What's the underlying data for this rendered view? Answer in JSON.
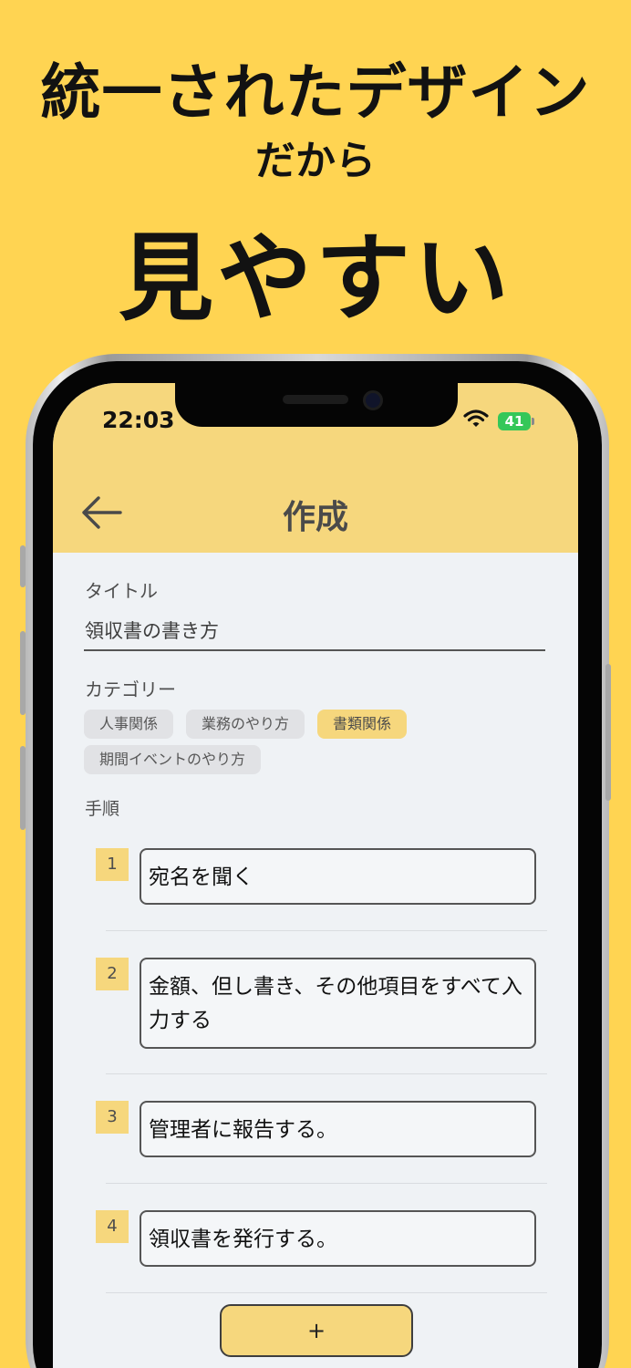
{
  "promo": {
    "line1": "統一されたデザイン",
    "line2": "だから",
    "line3": "見やすい"
  },
  "status_bar": {
    "time": "22:03",
    "battery": "41"
  },
  "header": {
    "title": "作成"
  },
  "form": {
    "title_label": "タイトル",
    "title_value": "領収書の書き方",
    "category_label": "カテゴリー",
    "categories": [
      {
        "label": "人事関係",
        "selected": false
      },
      {
        "label": "業務のやり方",
        "selected": false
      },
      {
        "label": "書類関係",
        "selected": true
      },
      {
        "label": "期間イベントのやり方",
        "selected": false
      }
    ],
    "steps_label": "手順",
    "steps": [
      {
        "number": "1",
        "text": "宛名を聞く"
      },
      {
        "number": "2",
        "text": "金額、但し書き、その他項目をすべて入力する"
      },
      {
        "number": "3",
        "text": "管理者に報告する。"
      },
      {
        "number": "4",
        "text": "領収書を発行する。"
      }
    ],
    "add_label": "+"
  },
  "colors": {
    "background": "#ffd452",
    "accent": "#f6d77d",
    "screen": "#eff2f5",
    "battery": "#35c759"
  },
  "icons": {
    "back": "arrow-left-icon",
    "wifi": "wifi-icon",
    "battery": "battery-icon"
  }
}
